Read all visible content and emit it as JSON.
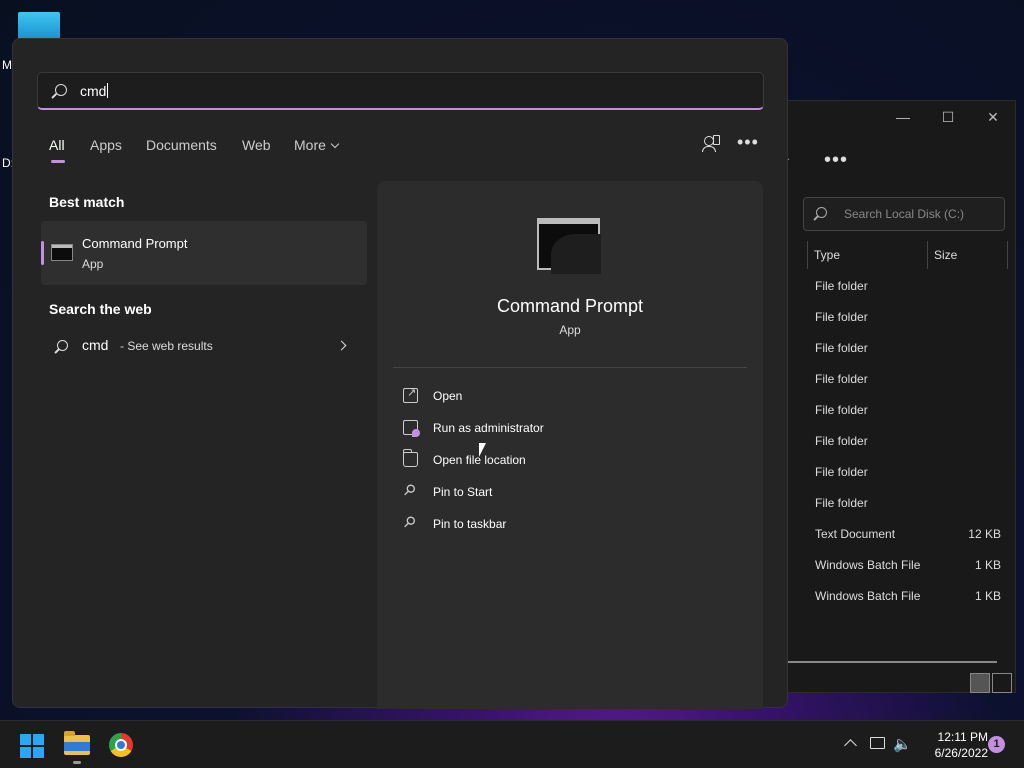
{
  "desktop": {
    "icon_label_1": "M",
    "icon_label_2": "D:"
  },
  "explorer": {
    "search_placeholder": "Search Local Disk (C:)",
    "columns": [
      "Type",
      "Size"
    ],
    "rows": [
      {
        "type": "File folder",
        "size": ""
      },
      {
        "type": "File folder",
        "size": ""
      },
      {
        "type": "File folder",
        "size": ""
      },
      {
        "type": "File folder",
        "size": ""
      },
      {
        "type": "File folder",
        "size": ""
      },
      {
        "type": "File folder",
        "size": ""
      },
      {
        "type": "File folder",
        "size": ""
      },
      {
        "type": "File folder",
        "size": ""
      },
      {
        "type": "Text Document",
        "size": "12 KB"
      },
      {
        "type": "Windows Batch File",
        "size": "1 KB"
      },
      {
        "type": "Windows Batch File",
        "size": "1 KB"
      }
    ]
  },
  "search": {
    "query": "cmd",
    "tabs": [
      "All",
      "Apps",
      "Documents",
      "Web",
      "More"
    ],
    "active_tab": "All",
    "best_match_title": "Best match",
    "best_match": {
      "name": "Command Prompt",
      "kind": "App"
    },
    "web_title": "Search the web",
    "web_query": "cmd",
    "web_suffix": "- See web results",
    "detail": {
      "name": "Command Prompt",
      "kind": "App",
      "actions": [
        "Open",
        "Run as administrator",
        "Open file location",
        "Pin to Start",
        "Pin to taskbar"
      ]
    }
  },
  "taskbar": {
    "time": "12:11 PM",
    "date": "6/26/2022",
    "notification_count": "1"
  },
  "colors": {
    "accent": "#c58fe0",
    "panel": "#242424",
    "taskbar": "#1c1c1c"
  }
}
